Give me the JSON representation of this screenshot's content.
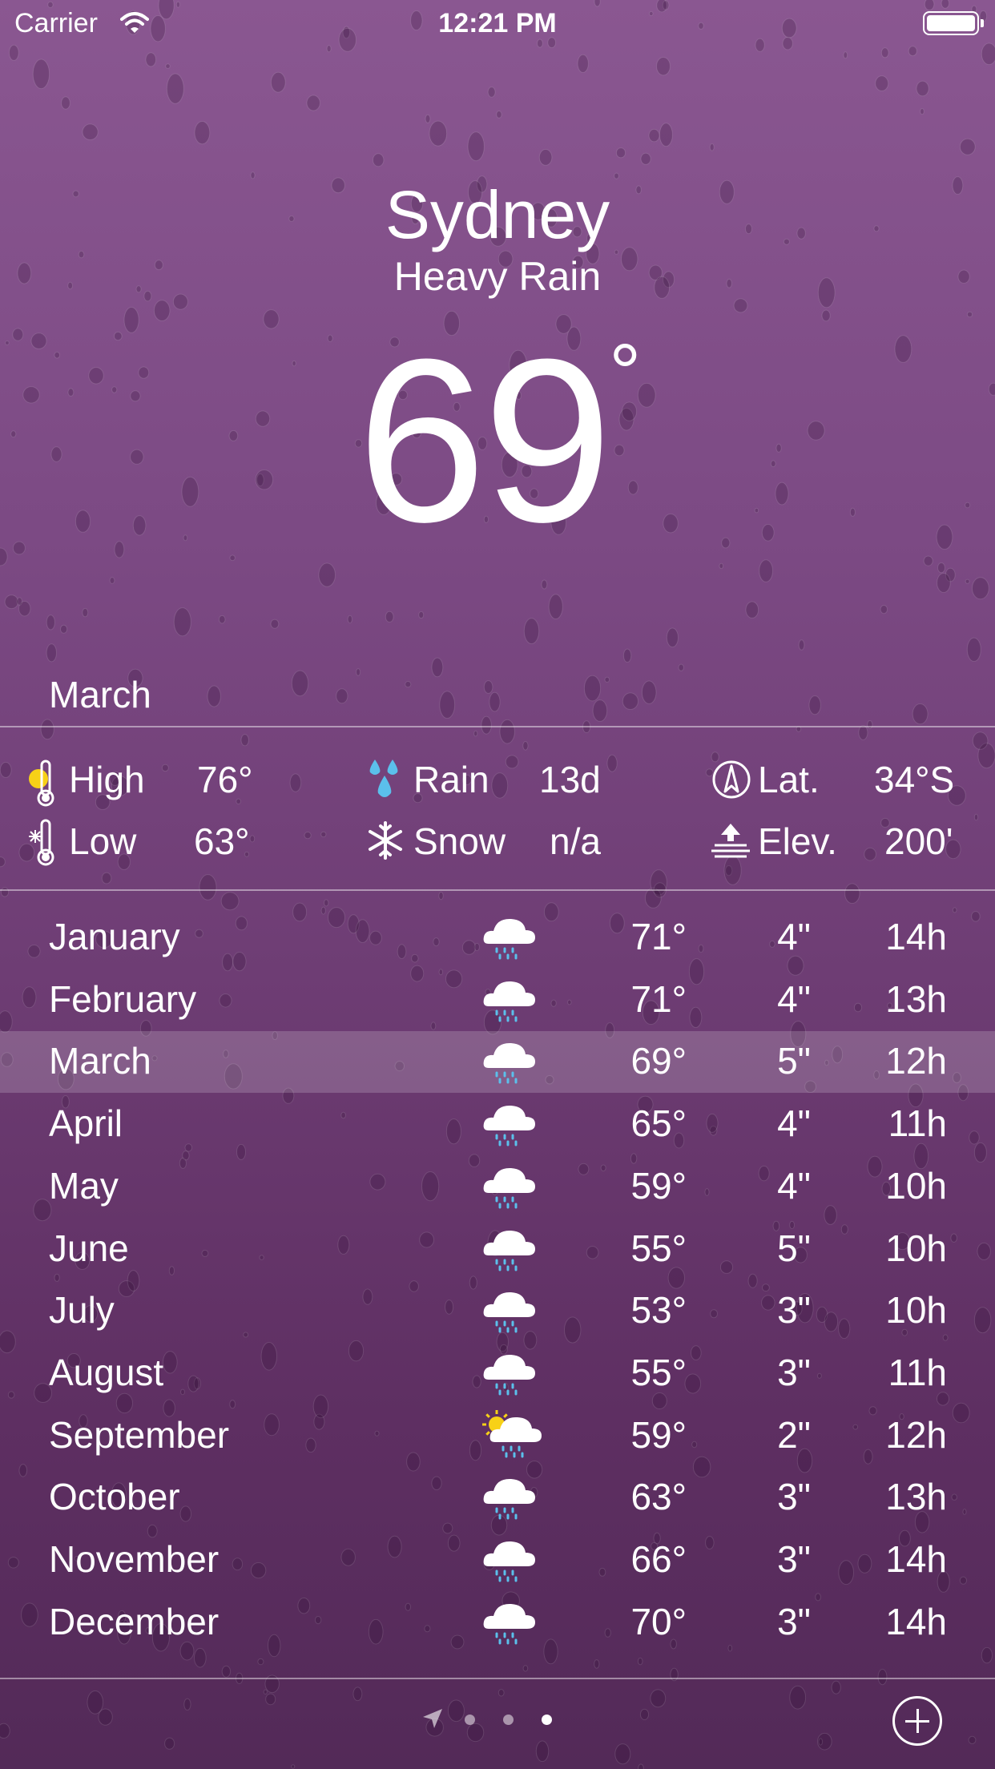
{
  "status_bar": {
    "carrier": "Carrier",
    "time": "12:21 PM"
  },
  "header": {
    "city": "Sydney",
    "condition": "Heavy Rain",
    "temperature": "69",
    "degree_symbol": "°"
  },
  "selected_month": "March",
  "stats": {
    "high": {
      "label": "High",
      "value": "76°"
    },
    "low": {
      "label": "Low",
      "value": "63°"
    },
    "rain": {
      "label": "Rain",
      "value": "13d"
    },
    "snow": {
      "label": "Snow",
      "value": "n/a"
    },
    "lat": {
      "label": "Lat.",
      "value": "34°S"
    },
    "elev": {
      "label": "Elev.",
      "value": "200'"
    }
  },
  "months": [
    {
      "name": "January",
      "icon": "rain-cloud-icon",
      "temp": "71°",
      "rain": "4\"",
      "hours": "14h"
    },
    {
      "name": "February",
      "icon": "rain-cloud-icon",
      "temp": "71°",
      "rain": "4\"",
      "hours": "13h"
    },
    {
      "name": "March",
      "icon": "rain-cloud-icon",
      "temp": "69°",
      "rain": "5\"",
      "hours": "12h"
    },
    {
      "name": "April",
      "icon": "rain-cloud-icon",
      "temp": "65°",
      "rain": "4\"",
      "hours": "11h"
    },
    {
      "name": "May",
      "icon": "rain-cloud-icon",
      "temp": "59°",
      "rain": "4\"",
      "hours": "10h"
    },
    {
      "name": "June",
      "icon": "rain-cloud-icon",
      "temp": "55°",
      "rain": "5\"",
      "hours": "10h"
    },
    {
      "name": "July",
      "icon": "rain-cloud-icon",
      "temp": "53°",
      "rain": "3\"",
      "hours": "10h"
    },
    {
      "name": "August",
      "icon": "rain-cloud-icon",
      "temp": "55°",
      "rain": "3\"",
      "hours": "11h"
    },
    {
      "name": "September",
      "icon": "sun-rain-cloud-icon",
      "temp": "59°",
      "rain": "2\"",
      "hours": "12h"
    },
    {
      "name": "October",
      "icon": "rain-cloud-icon",
      "temp": "63°",
      "rain": "3\"",
      "hours": "13h"
    },
    {
      "name": "November",
      "icon": "rain-cloud-icon",
      "temp": "66°",
      "rain": "3\"",
      "hours": "14h"
    },
    {
      "name": "December",
      "icon": "rain-cloud-icon",
      "temp": "70°",
      "rain": "3\"",
      "hours": "14h"
    }
  ],
  "colors": {
    "background_top": "#8a5791",
    "background_bottom": "#532a58",
    "rain_drop": "#5bc0eb",
    "sun": "#f7d117",
    "cloud": "#ffffff"
  },
  "pager": {
    "page_count": 3,
    "current_page": 3
  }
}
